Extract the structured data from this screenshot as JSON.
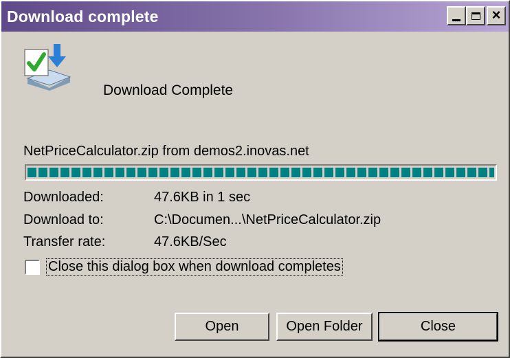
{
  "window": {
    "title": "Download complete",
    "colors": {
      "titlebar_start": "#5f4a89",
      "titlebar_end": "#b7a6d6",
      "progress": "#008080",
      "face": "#d4d0c8"
    }
  },
  "heading": "Download Complete",
  "source_line": "NetPriceCalculator.zip from demos2.inovas.net",
  "progress": {
    "fraction": 1.0
  },
  "info": {
    "downloaded_label": "Downloaded:",
    "downloaded_value": "47.6KB in 1 sec",
    "download_to_label": "Download to:",
    "download_to_value": "C:\\Documen...\\NetPriceCalculator.zip",
    "transfer_rate_label": "Transfer rate:",
    "transfer_rate_value": "47.6KB/Sec"
  },
  "checkbox": {
    "label": "Close this dialog box when download completes",
    "checked": false
  },
  "buttons": {
    "open": "Open",
    "open_folder": "Open Folder",
    "close": "Close"
  }
}
